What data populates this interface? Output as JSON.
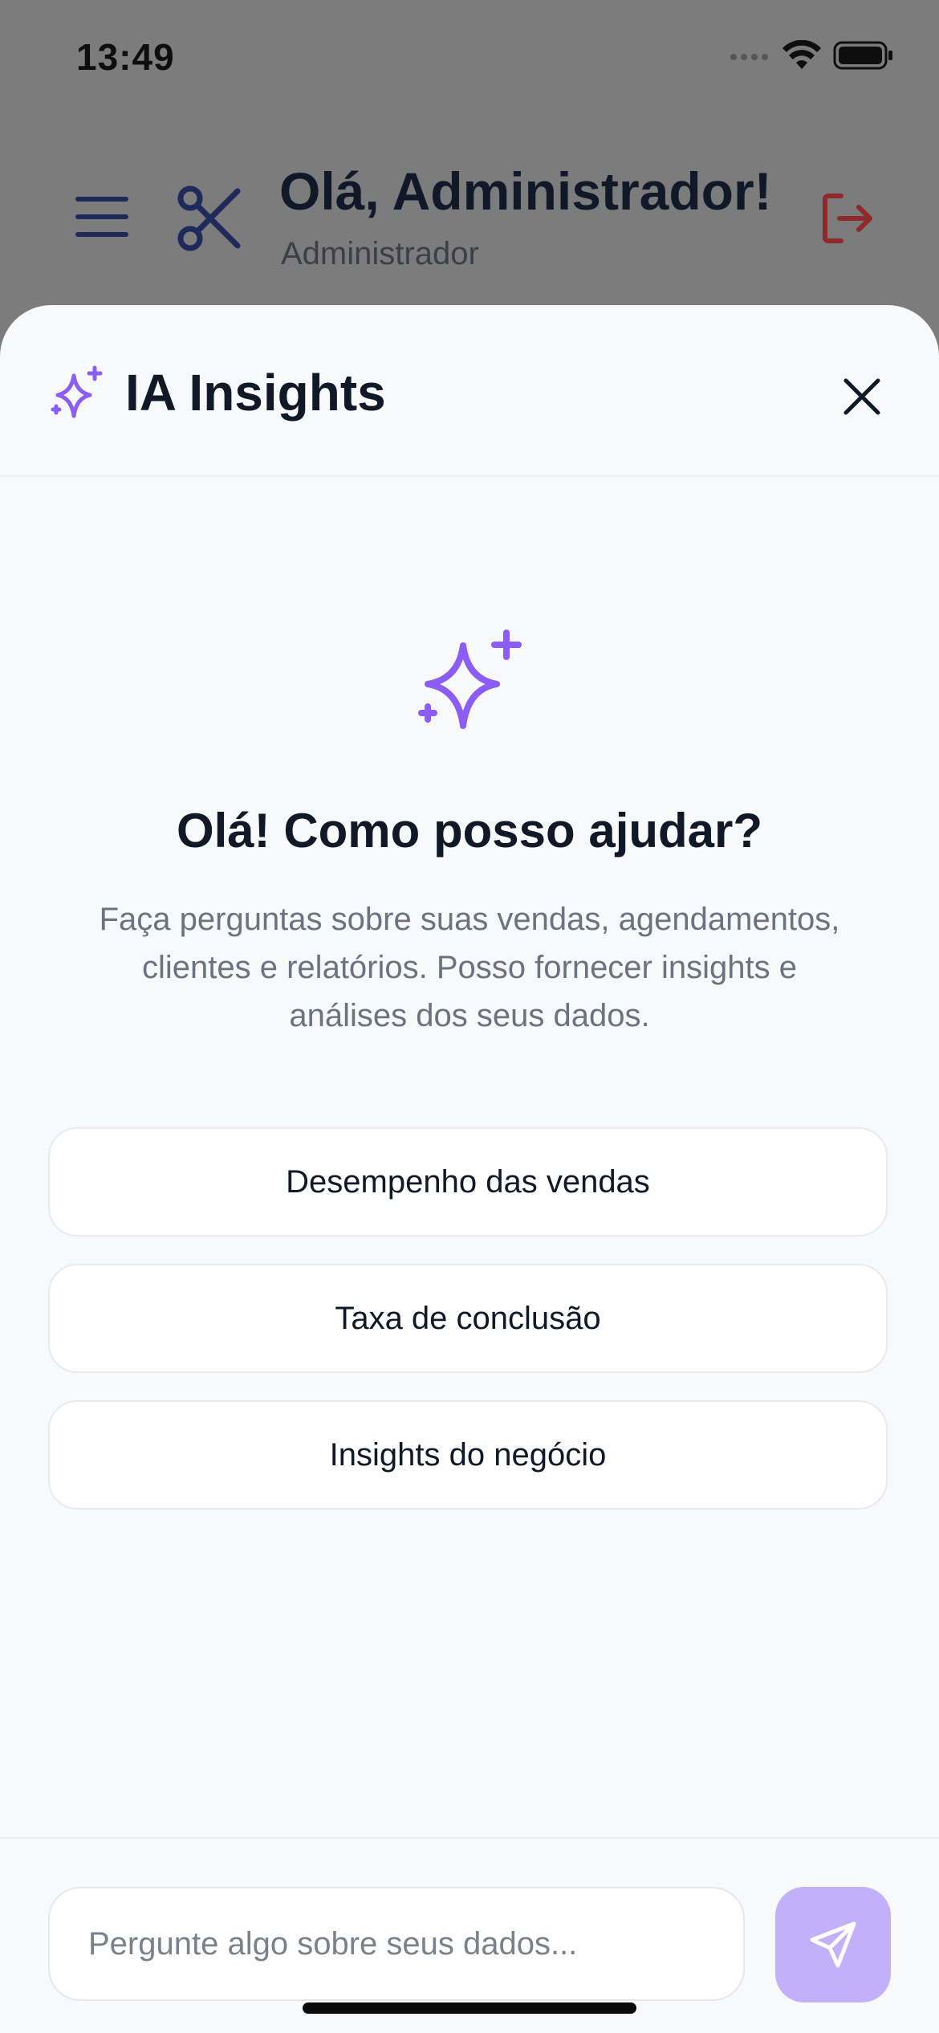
{
  "status_bar": {
    "time": "13:49"
  },
  "header": {
    "greeting": "Olá, Administrador!",
    "role": "Administrador"
  },
  "sheet": {
    "title": "IA Insights",
    "welcome_title": "Olá! Como posso ajudar?",
    "welcome_description": "Faça perguntas sobre suas vendas, agendamentos, clientes e relatórios. Posso fornecer insights e análises dos seus dados.",
    "suggestions": [
      "Desempenho das vendas",
      "Taxa de conclusão",
      "Insights do negócio"
    ],
    "input_placeholder": "Pergunte algo sobre seus dados..."
  },
  "colors": {
    "accent": "#8b5cf6",
    "send_button": "#c4b0fa",
    "logout": "#b91c1c",
    "header_icon": "#1e2a5a"
  },
  "icons": {
    "menu": "menu-icon",
    "brand": "scissors-icon",
    "logout": "logout-icon",
    "sparkles": "sparkles-icon",
    "close": "close-icon",
    "send": "send-icon"
  }
}
